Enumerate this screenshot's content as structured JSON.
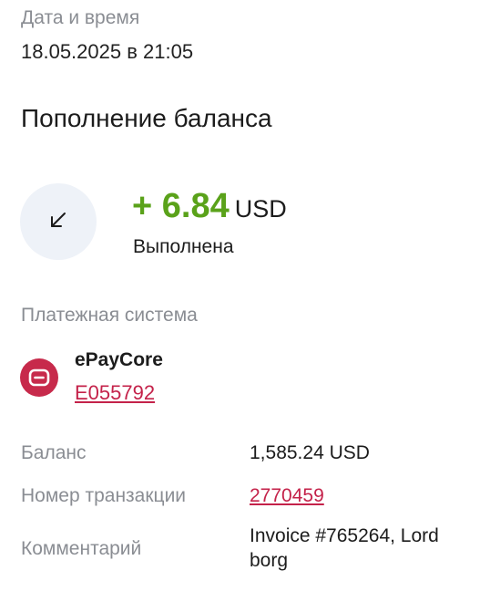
{
  "datetime": {
    "label": "Дата и время",
    "value": "18.05.2025 в 21:05"
  },
  "operation": {
    "title": "Пополнение баланса",
    "icon": "arrow-down-left-icon",
    "amount": "+ 6.84",
    "currency": "USD",
    "status": "Выполнена",
    "amount_color": "#5aa21a"
  },
  "payment_system": {
    "label": "Платежная система",
    "logo_icon": "epaycore-logo-icon",
    "name": "ePayCore",
    "account": "E055792",
    "brand_color": "#c72a4b"
  },
  "details": {
    "balance_label": "Баланс",
    "balance_value": "1,585.24 USD",
    "transaction_label": "Номер транзакции",
    "transaction_value": "2770459",
    "comment_label": "Комментарий",
    "comment_value": "Invoice #765264, Lord borg"
  }
}
